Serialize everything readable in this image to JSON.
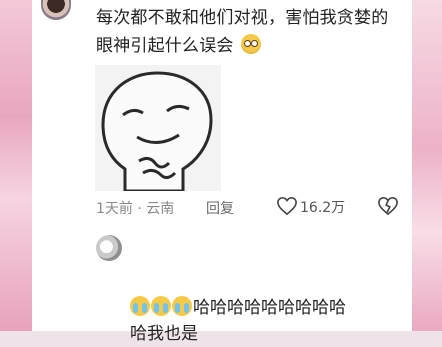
{
  "comment": {
    "text": "每次都不敢和他们对视，害怕我贪婪的眼神引起什么误会",
    "emoji_icon": "flushed-face-icon"
  },
  "sticker": {
    "icon": "smirking-cartoon-face-sticker"
  },
  "meta": {
    "time_location": "1天前 · 云南",
    "reply_label": "回复",
    "like_count": "16.2万",
    "like_icon": "heart-icon",
    "dislike_icon": "broken-heart-icon"
  },
  "reply": {
    "emoji_icon": "crying-laughing-face-icon",
    "line1": "哈哈哈哈哈哈哈哈哈",
    "line2": "哈我也是"
  },
  "colors": {
    "text": "#222222",
    "meta": "#8a8a8a",
    "side_pink": "#e9a6c0"
  }
}
